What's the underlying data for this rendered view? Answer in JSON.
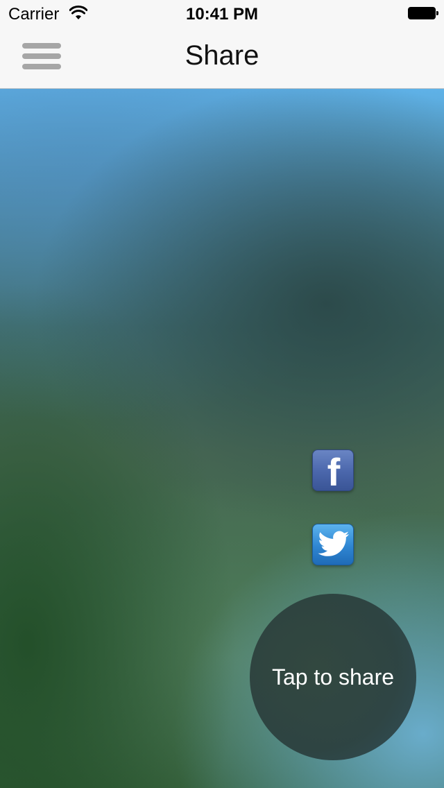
{
  "status_bar": {
    "carrier": "Carrier",
    "time": "10:41 PM",
    "wifi_icon": "wifi-icon",
    "battery_icon": "battery-icon"
  },
  "nav_bar": {
    "title": "Share",
    "menu_icon": "hamburger-menu-icon"
  },
  "share": {
    "facebook_icon": "facebook-icon",
    "twitter_icon": "twitter-icon",
    "tap_label": "Tap to share"
  },
  "colors": {
    "nav_background": "#f7f7f7",
    "menu_icon": "#a6a6a6",
    "facebook_blue": "#4a66ab",
    "twitter_blue": "#2f86d2",
    "share_circle": "#2f4640"
  }
}
